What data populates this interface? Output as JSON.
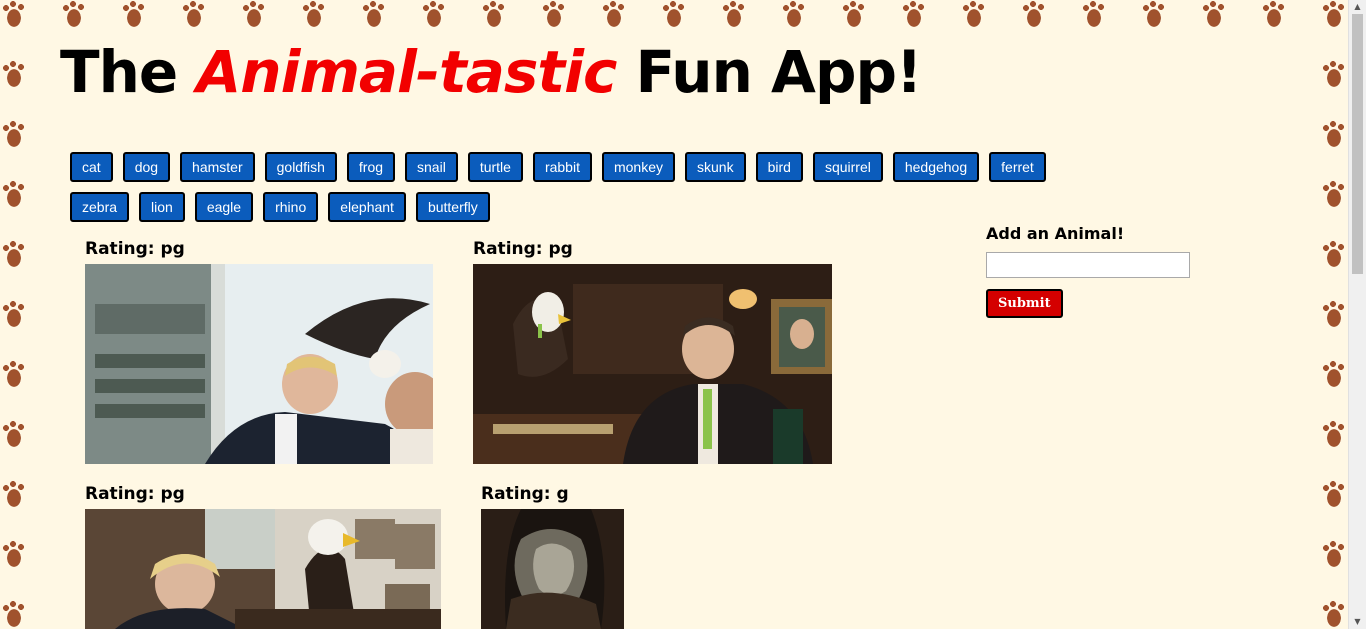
{
  "title": {
    "part1": "The ",
    "accent": "Animal-tastic",
    "part2": " Fun App!"
  },
  "animal_buttons": {
    "row1": [
      "cat",
      "dog",
      "hamster",
      "goldfish",
      "frog",
      "snail",
      "turtle",
      "rabbit",
      "monkey",
      "skunk",
      "bird",
      "squirrel",
      "hedgehog",
      "ferret"
    ],
    "row2": [
      "zebra",
      "lion",
      "eagle",
      "rhino",
      "elephant",
      "butterfly"
    ]
  },
  "gifs": [
    {
      "rating_label": "Rating: pg",
      "image": "eagle-with-man-in-office"
    },
    {
      "rating_label": "Rating: pg",
      "image": "eagle-at-desk-with-host"
    },
    {
      "rating_label": "Rating: pg",
      "image": "eagle-perched-beside-man-at-desk"
    },
    {
      "rating_label": "Rating: g",
      "image": "cave-opening"
    }
  ],
  "add_form": {
    "title": "Add an Animal!",
    "input_value": "",
    "submit_label": "Submit"
  },
  "colors": {
    "accent": "#f20000",
    "button_blue": "#0b5cbc",
    "submit_red": "#d40000",
    "background": "#fff8e4",
    "paw_brown": "#a0522d"
  }
}
